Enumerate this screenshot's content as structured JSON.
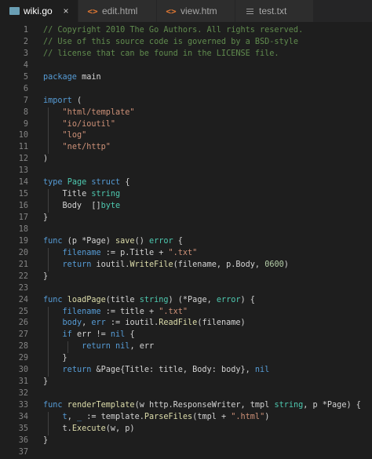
{
  "tabs": [
    {
      "label": "wiki.go",
      "icon": "go-file-icon",
      "active": true,
      "close": "×"
    },
    {
      "label": "edit.html",
      "icon": "html-file-icon",
      "active": false,
      "close": ""
    },
    {
      "label": "view.html",
      "icon": "html-file-icon",
      "active": false,
      "close": ""
    },
    {
      "label": "test.txt",
      "icon": "text-file-icon",
      "active": false,
      "close": ""
    }
  ],
  "editor": {
    "lines": [
      [
        [
          "c",
          "// Copyright 2010 The Go Authors. All rights reserved."
        ]
      ],
      [
        [
          "c",
          "// Use of this source code is governed by a BSD-style"
        ]
      ],
      [
        [
          "c",
          "// license that can be found in the LICENSE file."
        ]
      ],
      [],
      [
        [
          "k",
          "package"
        ],
        [
          "p",
          " main"
        ]
      ],
      [],
      [
        [
          "k",
          "import"
        ],
        [
          "p",
          " ("
        ]
      ],
      [
        [
          "p",
          "    "
        ],
        [
          "s",
          "\"html/template\""
        ]
      ],
      [
        [
          "p",
          "    "
        ],
        [
          "s",
          "\"io/ioutil\""
        ]
      ],
      [
        [
          "p",
          "    "
        ],
        [
          "s",
          "\"log\""
        ]
      ],
      [
        [
          "p",
          "    "
        ],
        [
          "s",
          "\"net/http\""
        ]
      ],
      [
        [
          "p",
          ")"
        ]
      ],
      [],
      [
        [
          "k",
          "type"
        ],
        [
          "p",
          " "
        ],
        [
          "y",
          "Page"
        ],
        [
          "p",
          " "
        ],
        [
          "k",
          "struct"
        ],
        [
          "p",
          " {"
        ]
      ],
      [
        [
          "p",
          "    Title "
        ],
        [
          "y",
          "string"
        ]
      ],
      [
        [
          "p",
          "    Body  []"
        ],
        [
          "y",
          "byte"
        ]
      ],
      [
        [
          "p",
          "}"
        ]
      ],
      [],
      [
        [
          "k",
          "func"
        ],
        [
          "p",
          " (p *Page) "
        ],
        [
          "f",
          "save"
        ],
        [
          "p",
          "() "
        ],
        [
          "y",
          "error"
        ],
        [
          "p",
          " {"
        ]
      ],
      [
        [
          "p",
          "    "
        ],
        [
          "k",
          "filename"
        ],
        [
          "p",
          " := p.Title + "
        ],
        [
          "s",
          "\".txt\""
        ]
      ],
      [
        [
          "p",
          "    "
        ],
        [
          "k",
          "return"
        ],
        [
          "p",
          " ioutil."
        ],
        [
          "f",
          "WriteFile"
        ],
        [
          "p",
          "(filename, p.Body, "
        ],
        [
          "n",
          "0600"
        ],
        [
          "p",
          ")"
        ]
      ],
      [
        [
          "p",
          "}"
        ]
      ],
      [],
      [
        [
          "k",
          "func"
        ],
        [
          "p",
          " "
        ],
        [
          "f",
          "loadPage"
        ],
        [
          "p",
          "(title "
        ],
        [
          "y",
          "string"
        ],
        [
          "p",
          ") (*Page, "
        ],
        [
          "y",
          "error"
        ],
        [
          "p",
          ") {"
        ]
      ],
      [
        [
          "p",
          "    "
        ],
        [
          "k",
          "filename"
        ],
        [
          "p",
          " := title + "
        ],
        [
          "s",
          "\".txt\""
        ]
      ],
      [
        [
          "p",
          "    "
        ],
        [
          "k",
          "body"
        ],
        [
          "p",
          ", "
        ],
        [
          "k",
          "err"
        ],
        [
          "p",
          " := ioutil."
        ],
        [
          "f",
          "ReadFile"
        ],
        [
          "p",
          "(filename)"
        ]
      ],
      [
        [
          "p",
          "    "
        ],
        [
          "k",
          "if"
        ],
        [
          "p",
          " err != "
        ],
        [
          "k",
          "nil"
        ],
        [
          "p",
          " {"
        ]
      ],
      [
        [
          "p",
          "        "
        ],
        [
          "k",
          "return"
        ],
        [
          "p",
          " "
        ],
        [
          "k",
          "nil"
        ],
        [
          "p",
          ", err"
        ]
      ],
      [
        [
          "p",
          "    }"
        ]
      ],
      [
        [
          "p",
          "    "
        ],
        [
          "k",
          "return"
        ],
        [
          "p",
          " &Page{Title: title, Body: body}, "
        ],
        [
          "k",
          "nil"
        ]
      ],
      [
        [
          "p",
          "}"
        ]
      ],
      [],
      [
        [
          "k",
          "func"
        ],
        [
          "p",
          " "
        ],
        [
          "f",
          "renderTemplate"
        ],
        [
          "p",
          "(w http.ResponseWriter, tmpl "
        ],
        [
          "y",
          "string"
        ],
        [
          "p",
          ", p *Page) {"
        ]
      ],
      [
        [
          "p",
          "    "
        ],
        [
          "k",
          "t"
        ],
        [
          "p",
          ", "
        ],
        [
          "k",
          "_"
        ],
        [
          "p",
          " := template."
        ],
        [
          "f",
          "ParseFiles"
        ],
        [
          "p",
          "(tmpl + "
        ],
        [
          "s",
          "\".html\""
        ],
        [
          "p",
          ")"
        ]
      ],
      [
        [
          "p",
          "    t."
        ],
        [
          "f",
          "Execute"
        ],
        [
          "p",
          "(w, p)"
        ]
      ],
      [
        [
          "p",
          "}"
        ]
      ],
      []
    ]
  },
  "colors": {
    "background": "#1e1e1e",
    "comment": "#608b4e",
    "keyword": "#569cd6",
    "string": "#ce9178",
    "type": "#4ec9b0",
    "function": "#dcdcaa",
    "number": "#b5cea8"
  }
}
